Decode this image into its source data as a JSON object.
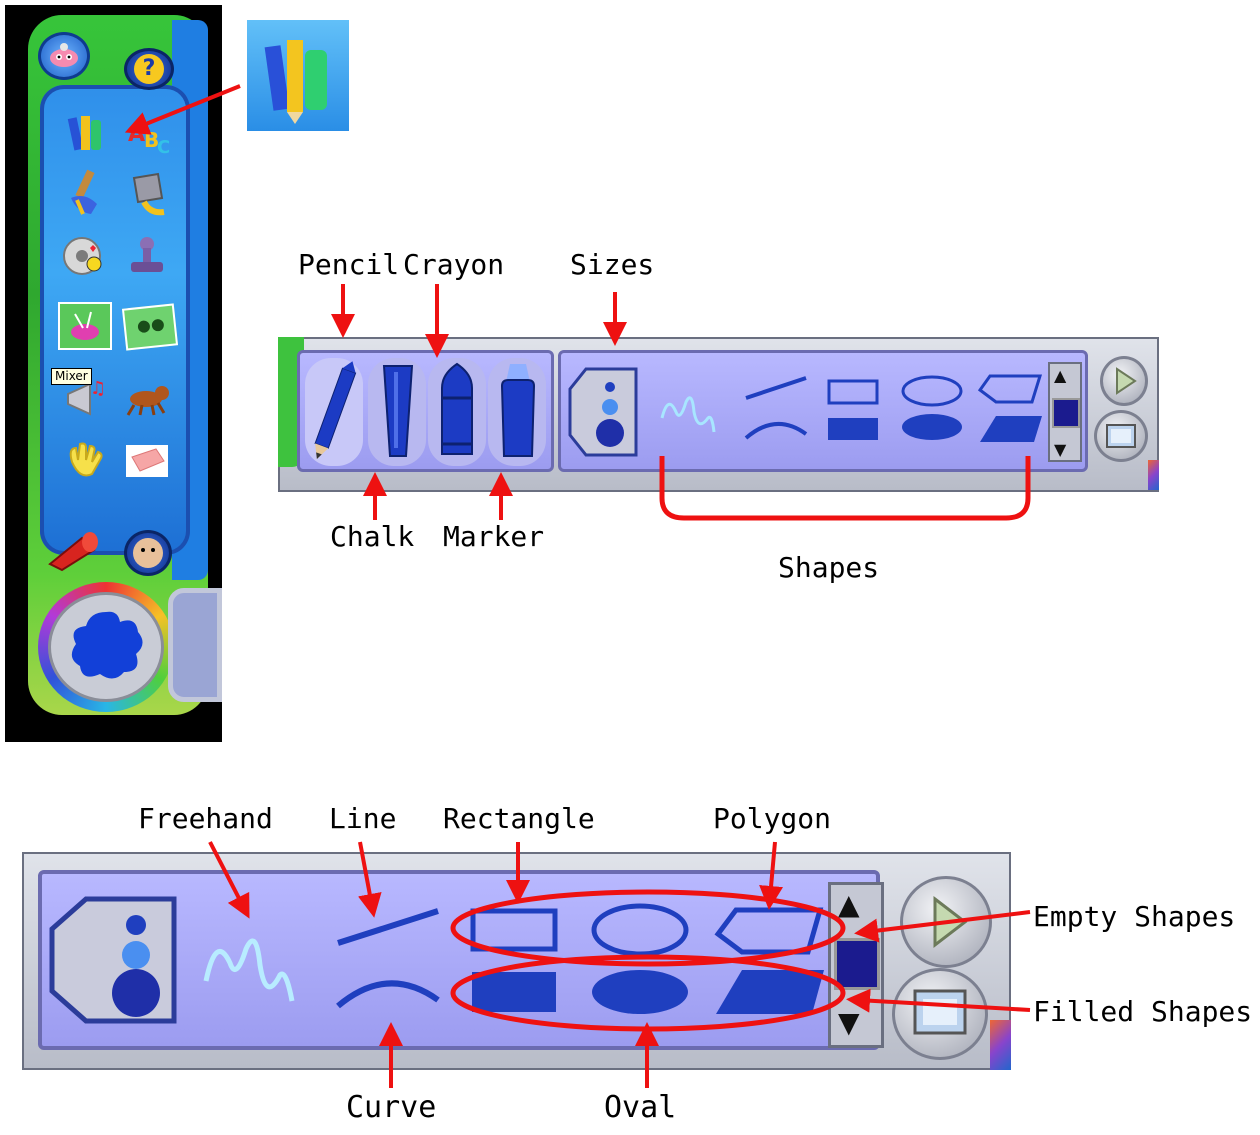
{
  "app_panel": {
    "tooltip": "Mixer",
    "tools": [
      {
        "name": "paint-tools",
        "icon": "pencil-crayons-icon"
      },
      {
        "name": "text",
        "icon": "abc-letters-icon"
      },
      {
        "name": "brushes",
        "icon": "paintbrush-icon"
      },
      {
        "name": "paint-bucket",
        "icon": "paint-bucket-icon"
      },
      {
        "name": "stickers",
        "icon": "sticker-roll-icon"
      },
      {
        "name": "stamps",
        "icon": "stamp-icon"
      },
      {
        "name": "backgrounds",
        "icon": "paint-pot-icon"
      },
      {
        "name": "photos",
        "icon": "photo-icon"
      },
      {
        "name": "mixer",
        "icon": "mixer-icon"
      },
      {
        "name": "animations",
        "icon": "dog-icon"
      },
      {
        "name": "magic-hand",
        "icon": "glove-icon"
      },
      {
        "name": "eraser",
        "icon": "eraser-icon"
      }
    ]
  },
  "toolbar1": {
    "labels": {
      "pencil": "Pencil",
      "crayon": "Crayon",
      "sizes": "Sizes",
      "chalk": "Chalk",
      "marker": "Marker",
      "shapes": "Shapes"
    }
  },
  "toolbar2": {
    "labels": {
      "freehand": "Freehand",
      "line": "Line",
      "rectangle": "Rectangle",
      "polygon": "Polygon",
      "empty_shapes": "Empty Shapes",
      "filled_shapes": "Filled Shapes",
      "curve": "Curve",
      "oval": "Oval"
    }
  },
  "colors": {
    "annotation": "#ee1111",
    "panel_lavender": "#a8a8f8",
    "tool_blue": "#1f3fbf",
    "app_green": "#33b833",
    "app_blue": "#2f8fea"
  }
}
